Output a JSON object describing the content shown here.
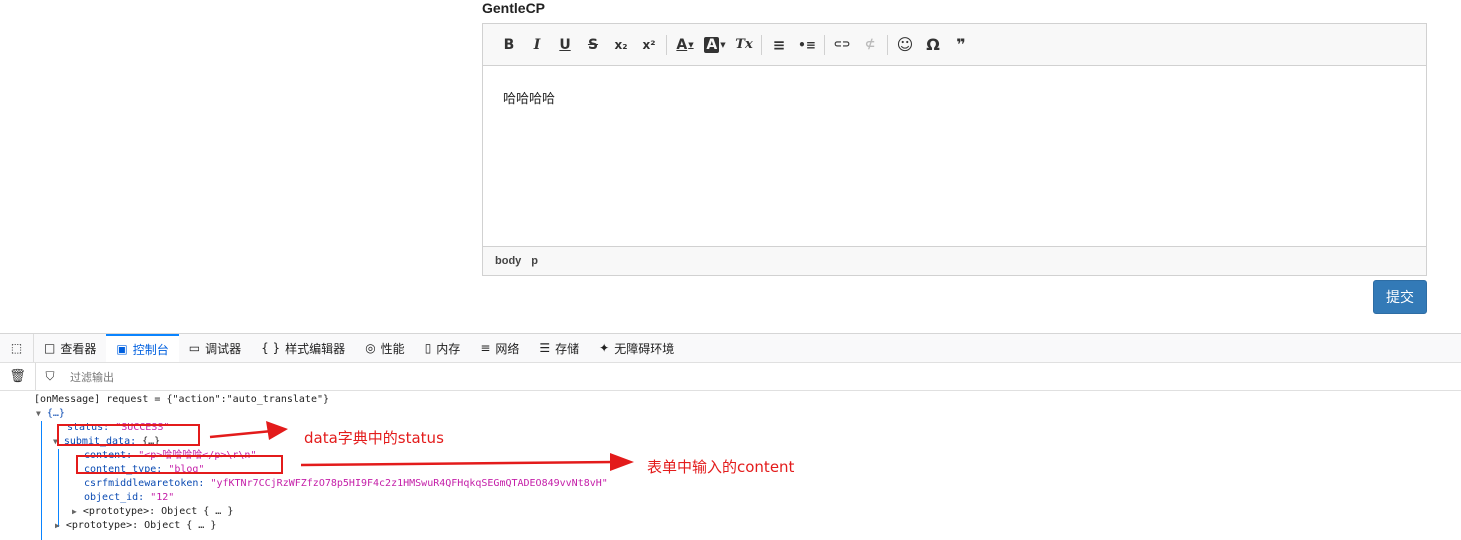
{
  "editor": {
    "title": "GentleCP",
    "toolbar": {
      "bold": "B",
      "italic": "I",
      "underline": "U",
      "strike": "S",
      "subscript": "x₂",
      "superscript": "x²",
      "text_color": "A",
      "bg_color": "A",
      "clear_format": "Tx",
      "ordered_list": "≡",
      "bullet_list": "•≡",
      "link": "⊂⊃",
      "unlink": "⊄",
      "emoji": "☺",
      "special_char": "Ω",
      "blockquote": "❞"
    },
    "content": "哈哈哈哈",
    "path": [
      "body",
      "p"
    ]
  },
  "submit_label": "提交",
  "devtools": {
    "tabs": [
      {
        "label": "查看器",
        "icon": "□"
      },
      {
        "label": "控制台",
        "icon": "▣"
      },
      {
        "label": "调试器",
        "icon": "▭"
      },
      {
        "label": "样式编辑器",
        "icon": "{ }"
      },
      {
        "label": "性能",
        "icon": "◎"
      },
      {
        "label": "内存",
        "icon": "▯"
      },
      {
        "label": "网络",
        "icon": "≡"
      },
      {
        "label": "存储",
        "icon": "☰"
      },
      {
        "label": "无障碍环境",
        "icon": "✦"
      }
    ],
    "filter_placeholder": "过滤输出",
    "console": {
      "line1": "[onMessage] request = {\"action\":\"auto_translate\"}",
      "obj_open": "{…}",
      "status_key": "status:",
      "status_val": "\"SUCCESS\"",
      "submit_key": "submit_data:",
      "submit_val": "{…}",
      "content_key": "content:",
      "content_val": "\"<p>哈哈哈哈</p>\\r\\n\"",
      "ctype_key": "content_type:",
      "ctype_val": "\"blog\"",
      "csrf_key": "csrfmiddlewaretoken:",
      "csrf_val": "\"yfKTNr7CCjRzWFZfzO78p5HI9F4c2z1HMSwuR4QFHqkqSEGmQTADEO849vvNt8vH\"",
      "objid_key": "object_id:",
      "objid_val": "\"12\"",
      "proto_inner": "<prototype>: Object { … }",
      "proto_outer": "<prototype>: Object { … }"
    }
  },
  "annotations": {
    "status_note": "data字典中的status",
    "content_note": "表单中输入的content"
  },
  "colors": {
    "annotation": "#e31b1b",
    "submit": "#337ab7",
    "active_tab": "#0060df",
    "string_value": "#c41ea8",
    "key": "#0b4bb3"
  }
}
